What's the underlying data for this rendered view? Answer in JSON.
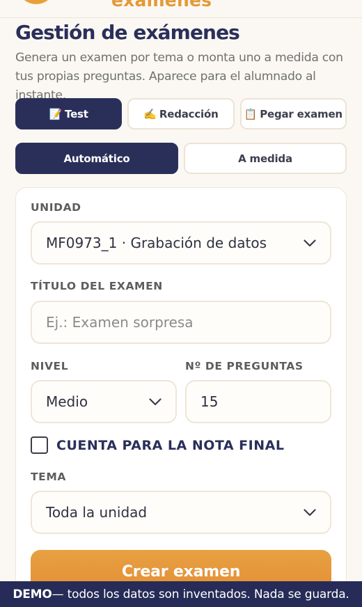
{
  "header": {
    "title": "exámenes"
  },
  "page": {
    "title": "Gestión de exámenes",
    "subtitle": "Genera un examen por tema o monta uno a medida con tus propias preguntas. Aparece para el alumnado al instante."
  },
  "exam_types": [
    {
      "emoji": "📝",
      "label": "Test",
      "active": true
    },
    {
      "emoji": "✍️",
      "label": "Redacción",
      "active": false
    },
    {
      "emoji": "📋",
      "label": "Pegar examen",
      "active": false
    }
  ],
  "modes": [
    {
      "label": "Automático",
      "active": true
    },
    {
      "label": "A medida",
      "active": false
    }
  ],
  "form": {
    "unit_label": "UNIDAD",
    "unit_value": "MF0973_1 · Grabación de datos",
    "title_label": "TÍTULO DEL EXAMEN",
    "title_placeholder": "Ej.: Examen sorpresa",
    "level_label": "NIVEL",
    "level_value": "Medio",
    "questions_label": "Nº DE PREGUNTAS",
    "questions_value": "15",
    "final_grade_label": "CUENTA PARA LA NOTA FINAL",
    "final_grade_checked": false,
    "topic_label": "TEMA",
    "topic_value": "Toda la unidad",
    "submit_label": "Crear examen"
  },
  "demo_banner": {
    "strong": "DEMO",
    "text": " — todos los datos son inventados. Nada se guarda."
  },
  "colors": {
    "primary": "#2a2f5a",
    "accent": "#e39a38",
    "background": "#fbf8f3"
  }
}
